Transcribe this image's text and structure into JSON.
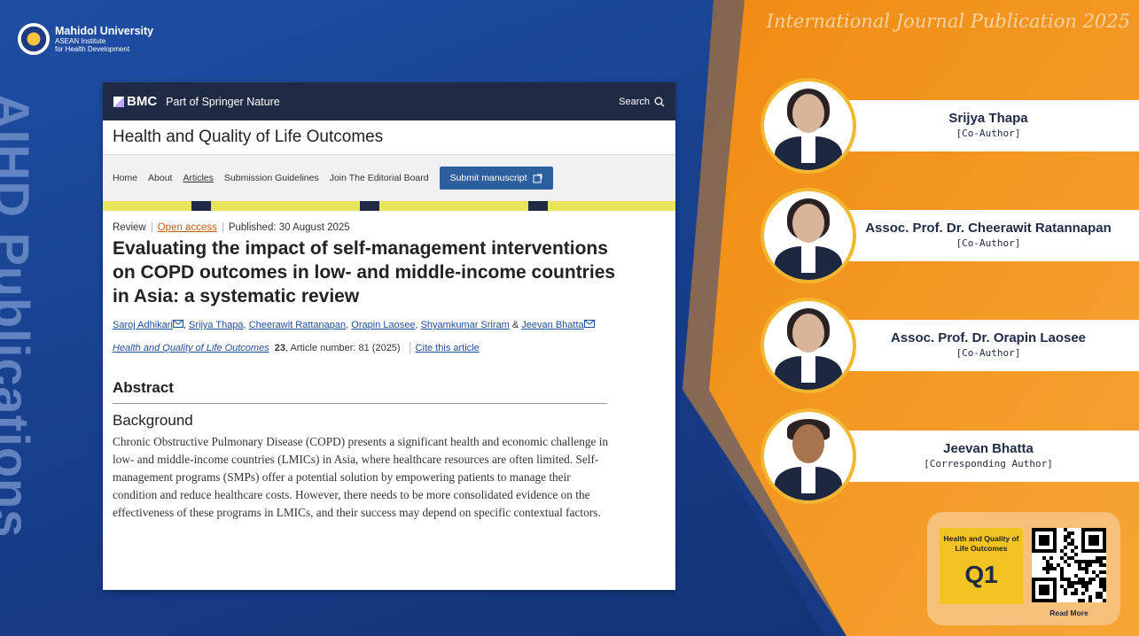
{
  "branding": {
    "university": "Mahidol University",
    "institute_line1": "ASEAN Institute",
    "institute_line2": "for Health Development",
    "vertical_title": "AIHD Publications",
    "banner": "International Journal Publication 2025"
  },
  "article_page": {
    "publisher": "BMC",
    "publisher_tagline": "Part of Springer Nature",
    "search_label": "Search",
    "journal_name": "Health and Quality of Life Outcomes",
    "nav": [
      "Home",
      "About",
      "Articles",
      "Submission Guidelines",
      "Join The Editorial Board"
    ],
    "submit_label": "Submit manuscript",
    "type": "Review",
    "access": "Open access",
    "published": "Published: 30 August 2025",
    "title": "Evaluating the impact of self-management interventions on COPD outcomes in low- and middle-income countries in Asia: a systematic review",
    "authors": [
      "Saroj Adhikari",
      "Srijya Thapa",
      "Cheerawit Rattanapan",
      "Orapin Laosee",
      "Shyamkumar Sriram",
      "Jeevan Bhatta"
    ],
    "amp": "&",
    "citation_journal": "Health and Quality of Life Outcomes",
    "citation_volume": "23",
    "citation_rest": ", Article number: 81 (2025)",
    "cite_link": "Cite this article",
    "abstract_heading": "Abstract",
    "background_heading": "Background",
    "background_text": "Chronic Obstructive Pulmonary Disease (COPD) presents a significant health and economic challenge in low- and middle-income countries (LMICs) in Asia, where healthcare resources are often limited. Self-management programs (SMPs) offer a potential solution by empowering patients to manage their condition and reduce healthcare costs. However, there needs to be more consolidated evidence on the effectiveness of these programs in LMICs, and their success may depend on specific contextual factors."
  },
  "people": [
    {
      "name": "Srijya Thapa",
      "role": "[Co-Author]"
    },
    {
      "name": "Assoc. Prof. Dr. Cheerawit Ratannapan",
      "role": "[Co-Author]"
    },
    {
      "name": "Assoc. Prof. Dr. Orapin Laosee",
      "role": "[Co-Author]"
    },
    {
      "name": "Jeevan Bhatta",
      "role": "[Corresponding Author]"
    }
  ],
  "quartile_box": {
    "journal": "Health and Quality of Life Outcomes",
    "rank": "Q1",
    "read_more": "Read More"
  },
  "colors": {
    "navy": "#1f2a44",
    "orange": "#f39a1f",
    "gold_ring": "#f2b630"
  }
}
